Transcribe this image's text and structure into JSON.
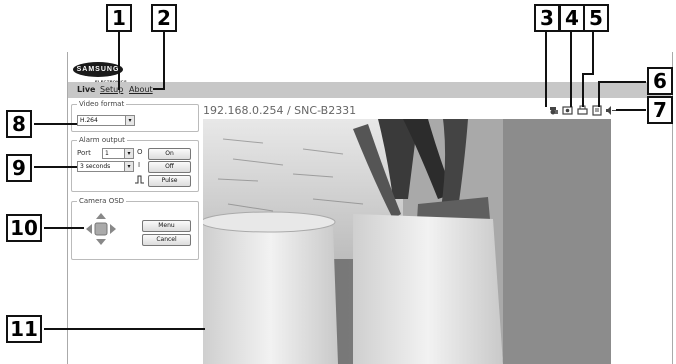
{
  "callouts": [
    "1",
    "2",
    "3",
    "4",
    "5",
    "6",
    "7",
    "8",
    "9",
    "10",
    "11"
  ],
  "brand": {
    "logo_text": "SAMSUNG",
    "sub_text": "ELECTRONICS"
  },
  "nav": {
    "live": "Live",
    "setup": "Setup",
    "about": "About"
  },
  "camera": {
    "address": "192.168.0.254 / SNC-B2331"
  },
  "toolbar_icons": [
    "record-icon",
    "snapshot-icon",
    "print-icon",
    "save-icon",
    "audio-icon"
  ],
  "video_format": {
    "legend": "Video format",
    "value": "H.264"
  },
  "alarm_output": {
    "legend": "Alarm output",
    "port_label": "Port",
    "port_value": "1",
    "duration_value": "3 seconds",
    "on_label": "On",
    "off_label": "Off",
    "pulse_label": "Pulse",
    "on_glyph": "O",
    "off_glyph": "I"
  },
  "camera_osd": {
    "legend": "Camera OSD",
    "menu_label": "Menu",
    "cancel_label": "Cancel",
    "center_label": "SET"
  }
}
